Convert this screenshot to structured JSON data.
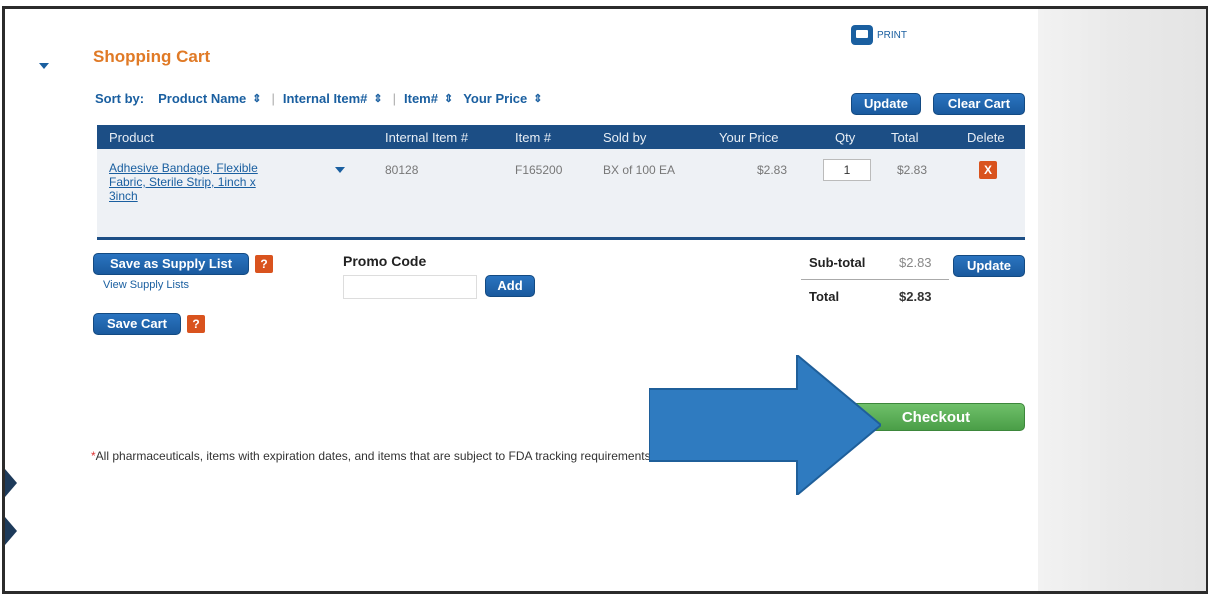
{
  "header": {
    "title": "Shopping Cart",
    "print_label": "PRINT"
  },
  "sort": {
    "label": "Sort by:",
    "options": [
      "Product Name",
      "Internal Item#",
      "Item#",
      "Your Price"
    ]
  },
  "toolbar": {
    "update_label": "Update",
    "clear_label": "Clear Cart"
  },
  "table": {
    "columns": [
      "Product",
      "Internal Item #",
      "Item #",
      "Sold by",
      "Your Price",
      "Qty",
      "Total",
      "Delete"
    ],
    "rows": [
      {
        "product_lines": [
          "Adhesive Bandage, Flexible",
          "Fabric, Sterile Strip, 1inch x",
          "3inch"
        ],
        "internal_item": "80128",
        "item": "F165200",
        "sold_by": "BX of 100 EA",
        "price": "$2.83",
        "qty": "1",
        "total": "$2.83",
        "delete_label": "X"
      }
    ]
  },
  "actions": {
    "save_supply_list": "Save as Supply List",
    "view_supply_lists": "View Supply Lists",
    "save_cart": "Save Cart",
    "help_label": "?"
  },
  "promo": {
    "label": "Promo Code",
    "value": "",
    "add_label": "Add"
  },
  "summary": {
    "subtotal_label": "Sub-total",
    "subtotal_value": "$2.83",
    "update_label": "Update",
    "total_label": "Total",
    "total_value": "$2.83"
  },
  "checkout": {
    "label": "Checkout"
  },
  "note": {
    "star": "*",
    "text": "All pharmaceuticals, items with expiration dates, and items that are subject to FDA tracking requirements are not returnable"
  },
  "colors": {
    "accent_orange": "#e07a26",
    "brand_blue": "#1a5fa0",
    "header_navy": "#1c4e85",
    "checkout_green": "#4a9e47",
    "arrow_blue": "#2f7bc0"
  }
}
